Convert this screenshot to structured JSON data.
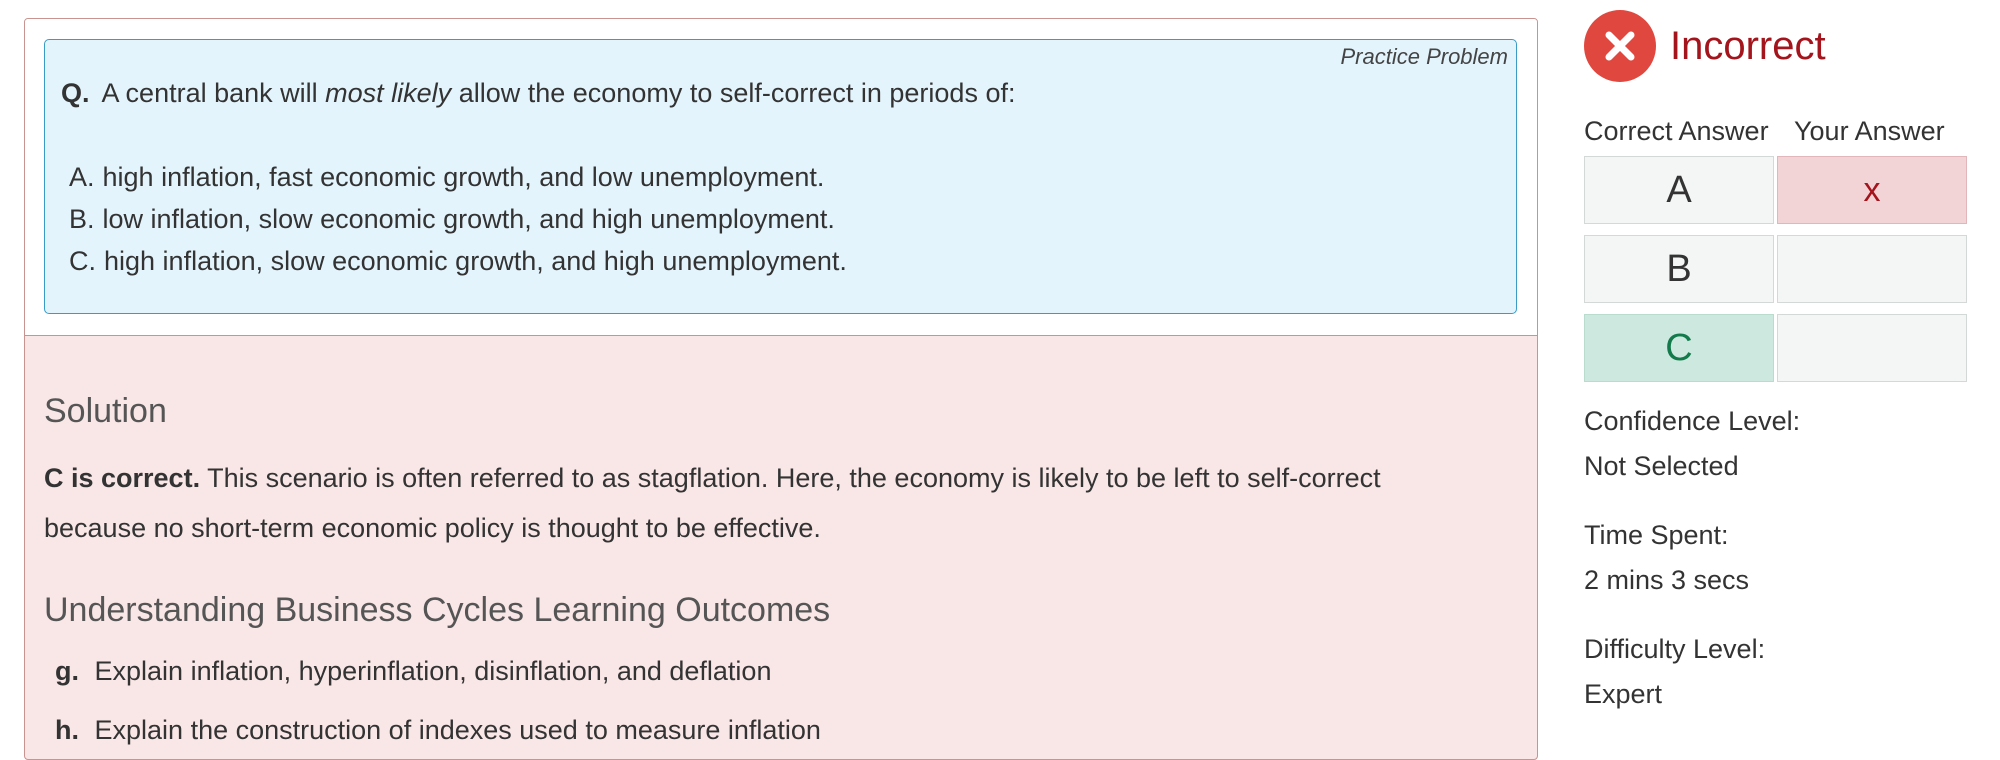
{
  "question": {
    "tag": "Practice Problem",
    "prefix": "Q.",
    "text_before": "A central bank will",
    "text_emphasis": "most likely",
    "text_after": "allow the economy to self-correct in periods of:",
    "options": [
      {
        "letter": "A.",
        "text": "high inflation, fast economic growth, and low unemployment."
      },
      {
        "letter": "B.",
        "text": "low inflation, slow economic growth, and high unemployment."
      },
      {
        "letter": "C.",
        "text": "high inflation, slow economic growth, and high unemployment."
      }
    ]
  },
  "solution": {
    "heading": "Solution",
    "correct_lead": "C is correct.",
    "line1_rest": "This scenario is often referred to as stagflation. Here, the economy is likely to be left to self-correct",
    "line2": "because no short-term economic policy is thought to be effective.",
    "outcomes_heading": "Understanding Business Cycles Learning Outcomes",
    "outcomes": [
      {
        "letter": "g.",
        "text": "Explain inflation, hyperinflation, disinflation, and deflation"
      },
      {
        "letter": "h.",
        "text": "Explain the construction of indexes used to measure inflation"
      }
    ]
  },
  "result": {
    "status": "Incorrect",
    "icon": "x-circle-icon",
    "status_color": "#a4141c",
    "correct_answer_header": "Correct Answer",
    "your_answer_header": "Your Answer",
    "rows": [
      {
        "correct": "A",
        "yours": "x"
      },
      {
        "correct": "B",
        "yours": ""
      },
      {
        "correct": "C",
        "yours": ""
      }
    ],
    "confidence_label": "Confidence Level:",
    "confidence_value": "Not Selected",
    "time_label": "Time Spent:",
    "time_value": "2 mins 3 secs",
    "difficulty_label": "Difficulty Level:",
    "difficulty_value": "Expert"
  }
}
